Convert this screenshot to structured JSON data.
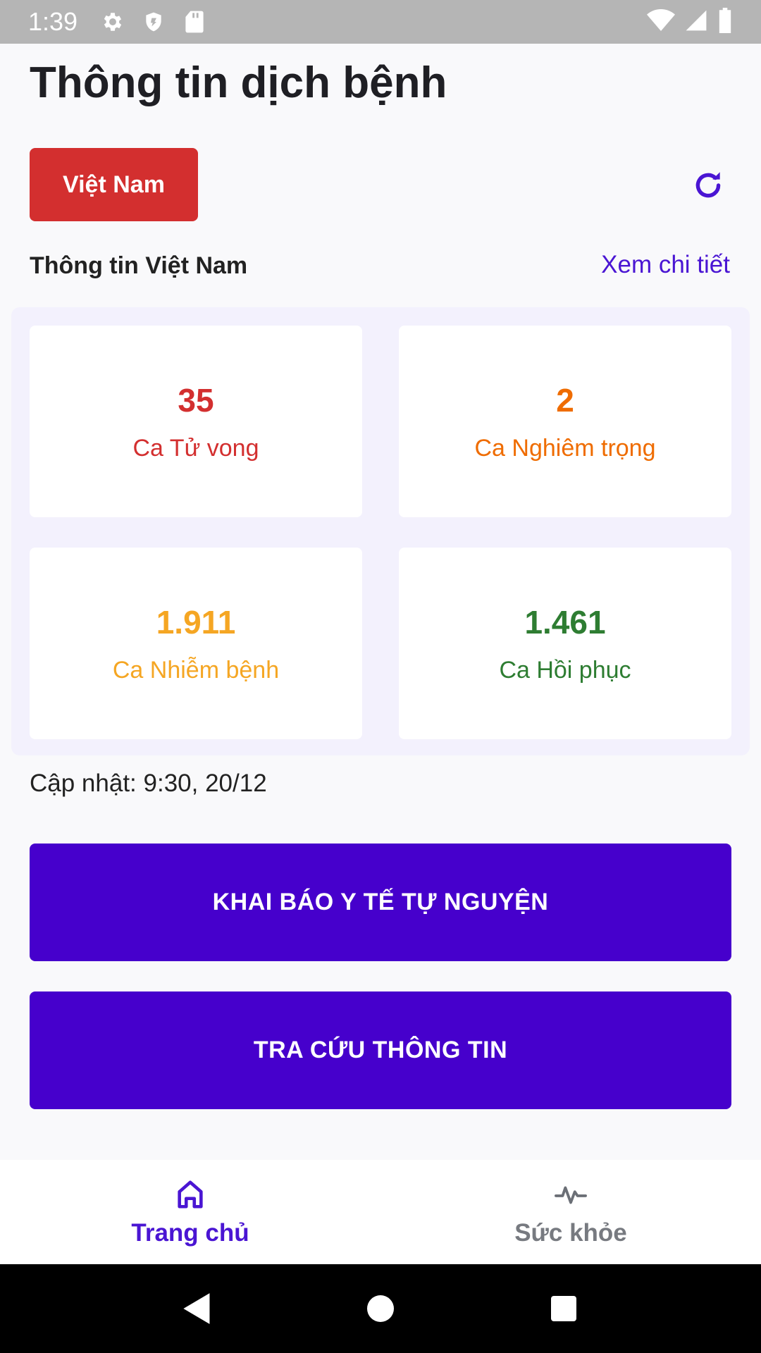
{
  "status_bar": {
    "time": "1:39",
    "icons": [
      "gear-icon",
      "shield-icon",
      "sd-card-icon",
      "wifi-icon",
      "signal-icon",
      "battery-icon"
    ]
  },
  "header": {
    "title": "Thông tin dịch bệnh"
  },
  "country_selector": {
    "label": "Việt Nam",
    "color": "#d32f2f"
  },
  "refresh": {
    "icon": "refresh-icon"
  },
  "summary": {
    "title": "Thông tin Việt Nam",
    "detail_link": "Xem chi tiết"
  },
  "stats": [
    {
      "value": "35",
      "label": "Ca Tử vong",
      "color": "#d32f2f"
    },
    {
      "value": "2",
      "label": "Ca Nghiêm trọng",
      "color": "#ef6c00"
    },
    {
      "value": "1.911",
      "label": "Ca Nhiễm bệnh",
      "color": "#f5a623"
    },
    {
      "value": "1.461",
      "label": "Ca Hồi phục",
      "color": "#2e7d32"
    }
  ],
  "update_text": "Cập nhật: 9:30, 20/12",
  "actions": {
    "declare_label": "KHAI BÁO Y TẾ TỰ NGUYỆN",
    "lookup_label": "TRA CỨU THÔNG TIN",
    "color": "#4600cc"
  },
  "bottom_nav": {
    "items": [
      {
        "label": "Trang chủ",
        "icon": "home-icon",
        "active": true,
        "color": "#4a15d3"
      },
      {
        "label": "Sức khỏe",
        "icon": "pulse-icon",
        "active": false,
        "color": "#777a80"
      }
    ]
  },
  "system_nav": {
    "icons": [
      "back-icon",
      "home-circle-icon",
      "recents-icon"
    ]
  }
}
